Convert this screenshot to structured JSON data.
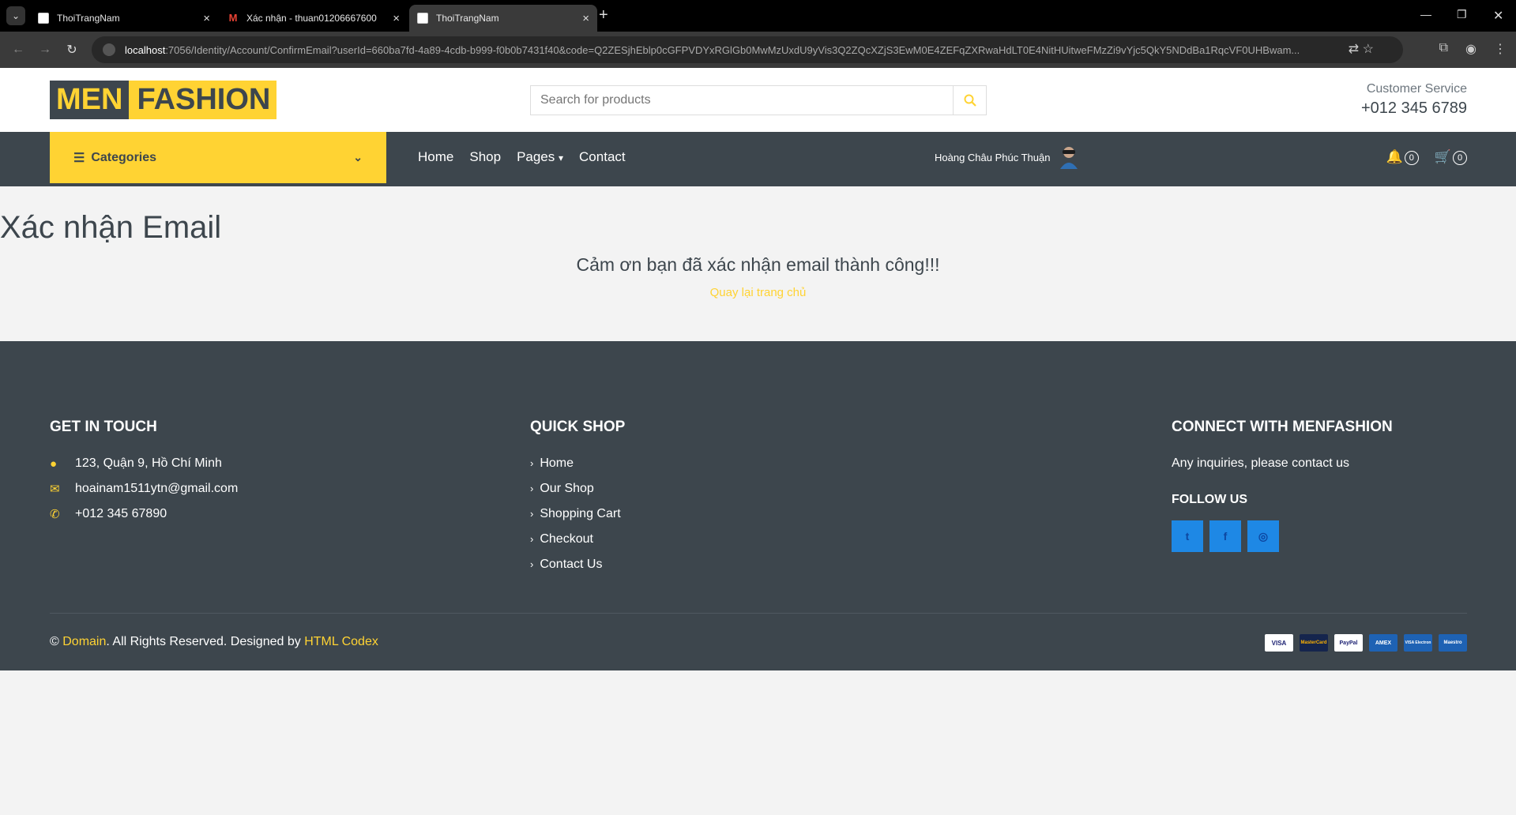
{
  "browser": {
    "tabs": [
      {
        "title": "ThoiTrangNam"
      },
      {
        "title": "Xác nhận - thuan01206667600"
      },
      {
        "title": "ThoiTrangNam"
      }
    ],
    "url_host": "localhost",
    "url_path": ":7056/Identity/Account/ConfirmEmail?userId=660ba7fd-4a89-4cdb-b999-f0b0b7431f40&code=Q2ZESjhEblp0cGFPVDYxRGlGb0MwMzUxdU9yVis3Q2ZQcXZjS3EwM0E4ZEFqZXRwaHdLT0E4NitHUitweFMzZi9vYjc5QkY5NDdBa1RqcVF0UHBwam..."
  },
  "header": {
    "logo_part1": "MEN",
    "logo_part2": "FASHION",
    "search_placeholder": "Search for products",
    "customer_service_label": "Customer Service",
    "customer_service_phone": "+012 345 6789"
  },
  "nav": {
    "categories_label": "Categories",
    "items": [
      "Home",
      "Shop",
      "Pages",
      "Contact"
    ],
    "user_name": "Hoàng Châu Phúc Thuận",
    "notif_count": "0",
    "cart_count": "0"
  },
  "main": {
    "title": "Xác nhận Email",
    "message": "Cảm ơn bạn đã xác nhận email thành công!!!",
    "back_link": "Quay lại trang chủ"
  },
  "footer": {
    "get_in_touch": {
      "heading": "Get In Touch",
      "address": "123, Quận 9, Hồ Chí Minh",
      "email": "hoainam1511ytn@gmail.com",
      "phone": "+012 345 67890"
    },
    "quick_shop": {
      "heading": "Quick Shop",
      "links": [
        "Home",
        "Our Shop",
        "Shopping Cart",
        "Checkout",
        "Contact Us"
      ]
    },
    "connect": {
      "heading": "Connect With MenFashion",
      "text": "Any inquiries, please contact us",
      "follow_heading": "Follow Us"
    },
    "copyright": {
      "symbol": "©",
      "domain": "Domain",
      "rights": ". All Rights Reserved. Designed by",
      "designer": "HTML Codex"
    },
    "payments": [
      "VISA",
      "MasterCard",
      "PayPal",
      "AMEX",
      "VISA Electron",
      "Maestro"
    ]
  },
  "colors": {
    "accent": "#ffd333",
    "dark": "#3d464d",
    "social": "#1e88e5"
  }
}
